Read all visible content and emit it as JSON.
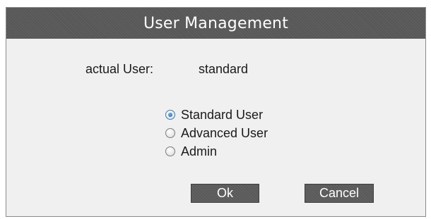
{
  "dialog": {
    "title": "User Management",
    "actual_user_label": "actual User:",
    "actual_user_value": "standard",
    "options": [
      {
        "label": "Standard User",
        "selected": true
      },
      {
        "label": "Advanced User",
        "selected": false
      },
      {
        "label": "Admin",
        "selected": false
      }
    ],
    "ok_label": "Ok",
    "cancel_label": "Cancel"
  },
  "colors": {
    "title_bar": "#575757",
    "dialog_bg": "#f0f0f0",
    "button_bg": "#5a5a5a",
    "radio_selected": "#1f70c8"
  }
}
